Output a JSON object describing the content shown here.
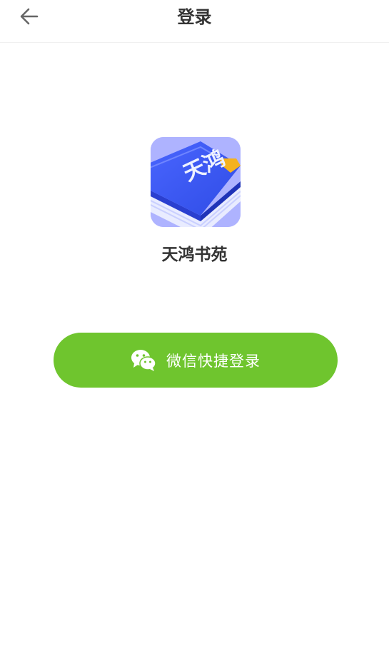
{
  "header": {
    "title": "登录",
    "back_icon": "arrow-left-icon"
  },
  "app": {
    "name": "天鸿书苑",
    "logo_text": "天鸿"
  },
  "login": {
    "wechat_label": "微信快捷登录",
    "wechat_icon": "wechat-icon",
    "button_color": "#6fc52e"
  }
}
